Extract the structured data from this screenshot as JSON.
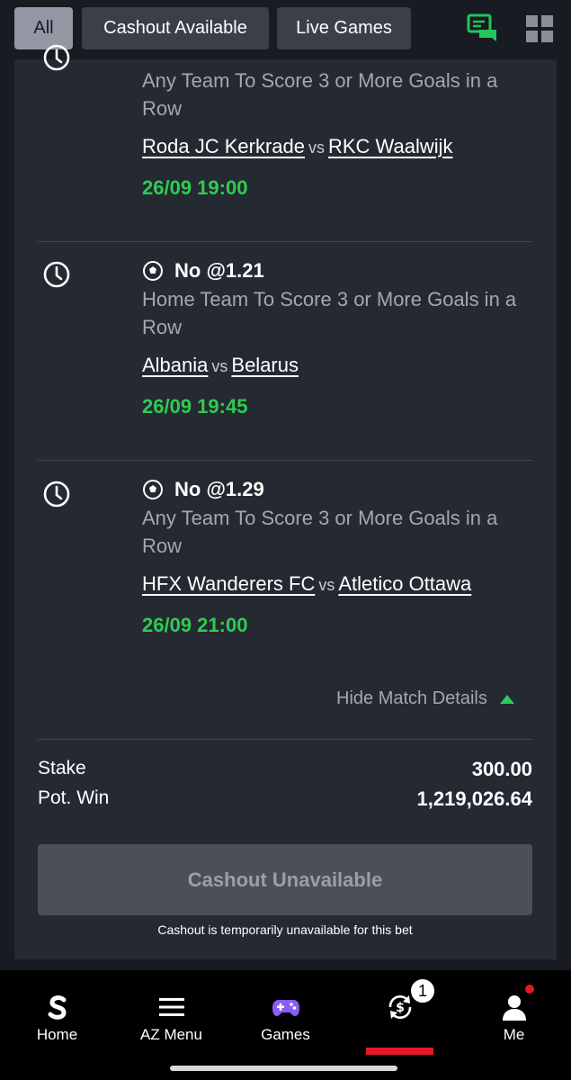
{
  "filters": {
    "tabs": [
      {
        "label": "All",
        "active": true
      },
      {
        "label": "Cashout Available",
        "active": false
      },
      {
        "label": "Live Games",
        "active": false
      }
    ],
    "icons": [
      "chat-icon",
      "grid-icon"
    ],
    "chat_icon_color": "#22c55e"
  },
  "legs": [
    {
      "selection": "",
      "market": "Any Team To Score 3 or More Goals in a Row",
      "home": "Roda JC Kerkrade",
      "vs": "vs",
      "away": "RKC Waalwijk",
      "kickoff": "26/09 19:00"
    },
    {
      "selection": "No @1.21",
      "market": "Home Team To Score 3 or More Goals in a Row",
      "home": "Albania",
      "vs": "vs",
      "away": "Belarus",
      "kickoff": "26/09 19:45"
    },
    {
      "selection": "No @1.29",
      "market": "Any Team To Score 3 or More Goals in a Row",
      "home": "HFX Wanderers FC",
      "vs": "vs",
      "away": "Atletico Ottawa",
      "kickoff": "26/09 21:00"
    }
  ],
  "details_toggle": "Hide Match Details",
  "summary": {
    "stake_label": "Stake",
    "stake_value": "300.00",
    "pot_win_label": "Pot. Win",
    "pot_win_value": "1,219,026.64"
  },
  "cashout": {
    "button_label": "Cashout Unavailable",
    "note": "Cashout is temporarily unavailable for this bet"
  },
  "nav": {
    "items": [
      {
        "label": "Home",
        "icon": "sporty-logo-icon"
      },
      {
        "label": "AZ Menu",
        "icon": "hamburger-menu-icon"
      },
      {
        "label": "Games",
        "icon": "gamepad-icon"
      },
      {
        "label": "",
        "icon": "cashout-coin-icon",
        "active": true
      },
      {
        "label": "Me",
        "icon": "user-icon"
      }
    ],
    "open_bets_badge": "1"
  },
  "colors": {
    "accent_green": "#2ecc52",
    "brand_red": "#e41827",
    "background": "#181b21",
    "card": "#252931"
  }
}
